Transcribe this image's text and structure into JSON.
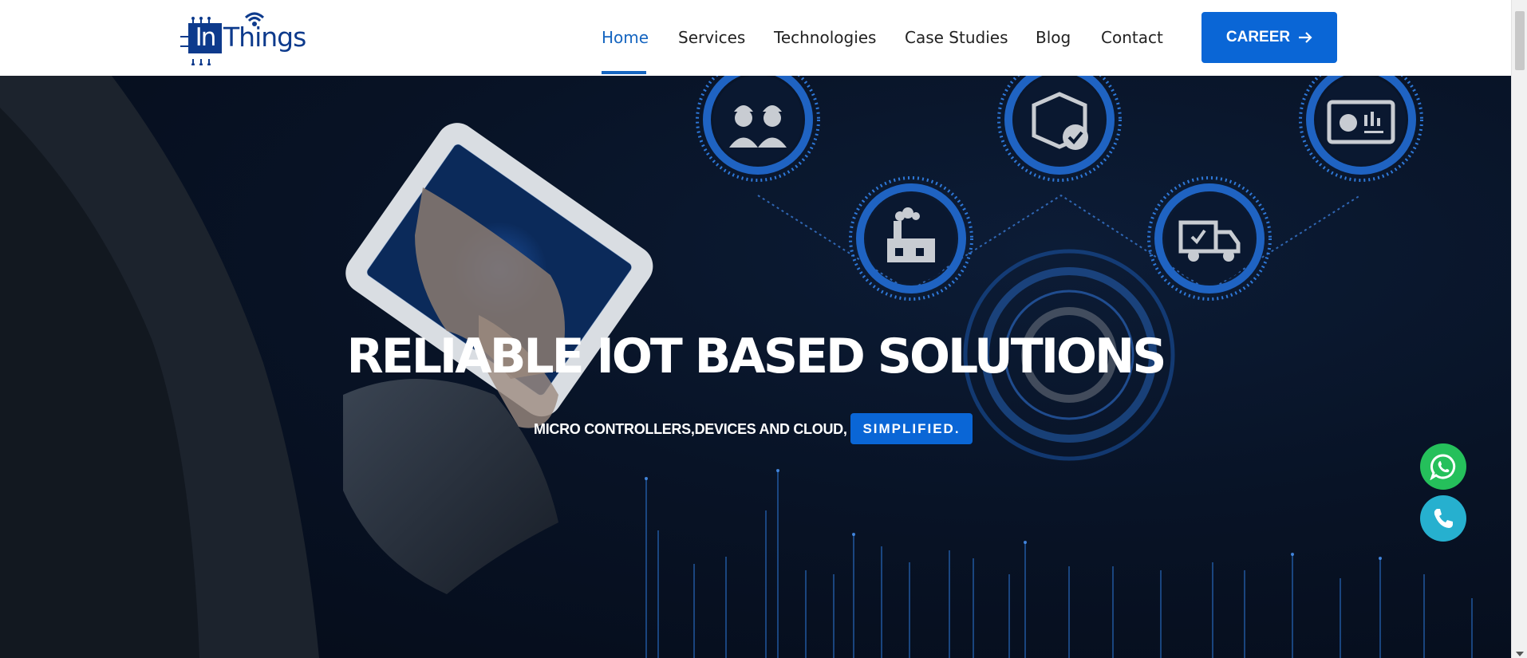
{
  "brand": {
    "logo_in": "In",
    "logo_rest": "Things"
  },
  "nav": {
    "items": [
      {
        "label": "Home",
        "active": true
      },
      {
        "label": "Services"
      },
      {
        "label": "Technologies"
      },
      {
        "label": "Case Studies"
      },
      {
        "label": "Blog"
      },
      {
        "label": "Contact"
      }
    ],
    "cta_label": "CAREER",
    "cta_icon": "arrow-right-icon"
  },
  "hero": {
    "title": "RELIABLE IOT BASED SOLUTIONS",
    "subtitle": "MICRO CONTROLLERS,DEVICES AND CLOUD,",
    "badge": "SIMPLIFIED.",
    "node_icons": [
      "workers-icon",
      "factory-icon",
      "package-check-icon",
      "delivery-truck-icon",
      "dashboard-report-icon"
    ]
  },
  "floating": {
    "whatsapp_icon": "whatsapp-icon",
    "phone_icon": "phone-icon"
  },
  "colors": {
    "accent": "#0a66d6",
    "brand_dark": "#0d3a8c",
    "whatsapp": "#25c05b",
    "phone": "#26b0cf",
    "hero_bg": "#081326"
  }
}
